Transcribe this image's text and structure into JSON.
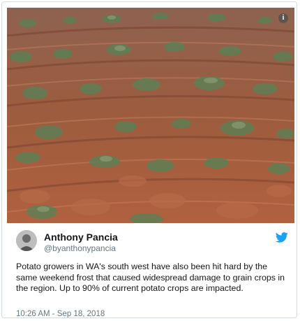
{
  "media": {
    "alt": "Frost-damaged potato crop rows in red soil",
    "info_icon": "info-icon"
  },
  "author": {
    "name": "Anthony Pancia",
    "handle": "@byanthonypancia",
    "platform_icon": "twitter-bird-icon"
  },
  "tweet": {
    "text": "Potato growers in WA's south west have also been hit hard by the same weekend frost that caused widespread damage to grain crops in the region. Up to 90% of current potato crops are impacted."
  },
  "meta": {
    "timestamp": "10:26 AM - Sep 18, 2018"
  },
  "colors": {
    "soil": "#9a5a3f",
    "plant": "#5f7f55",
    "twitter_blue": "#1da1f2",
    "secondary_text": "#657786"
  }
}
